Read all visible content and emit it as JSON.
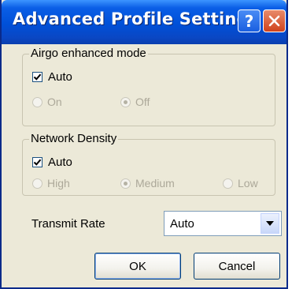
{
  "window": {
    "title": "Advanced Profile Settings",
    "help_label": "?",
    "close_label": "✕"
  },
  "airgo": {
    "legend": "Airgo enhanced mode",
    "auto_label": "Auto",
    "auto_checked": true,
    "options": [
      {
        "label": "On",
        "selected": false,
        "enabled": false
      },
      {
        "label": "Off",
        "selected": true,
        "enabled": false
      }
    ]
  },
  "network_density": {
    "legend": "Network Density",
    "auto_label": "Auto",
    "auto_checked": true,
    "options": [
      {
        "label": "High",
        "selected": false,
        "enabled": false
      },
      {
        "label": "Medium",
        "selected": true,
        "enabled": false
      },
      {
        "label": "Low",
        "selected": false,
        "enabled": false
      }
    ]
  },
  "transmit_rate": {
    "label": "Transmit Rate",
    "value": "Auto"
  },
  "buttons": {
    "ok_label": "OK",
    "cancel_label": "Cancel"
  },
  "icons": {
    "help": "help-icon",
    "close": "close-icon",
    "check": "checkmark-icon",
    "dropdown": "chevron-down-icon"
  },
  "colors": {
    "titlebar": "#0050d8",
    "dialog_background": "#ece9d8",
    "close_button": "#d0421c",
    "disabled_text": "#aca899"
  }
}
